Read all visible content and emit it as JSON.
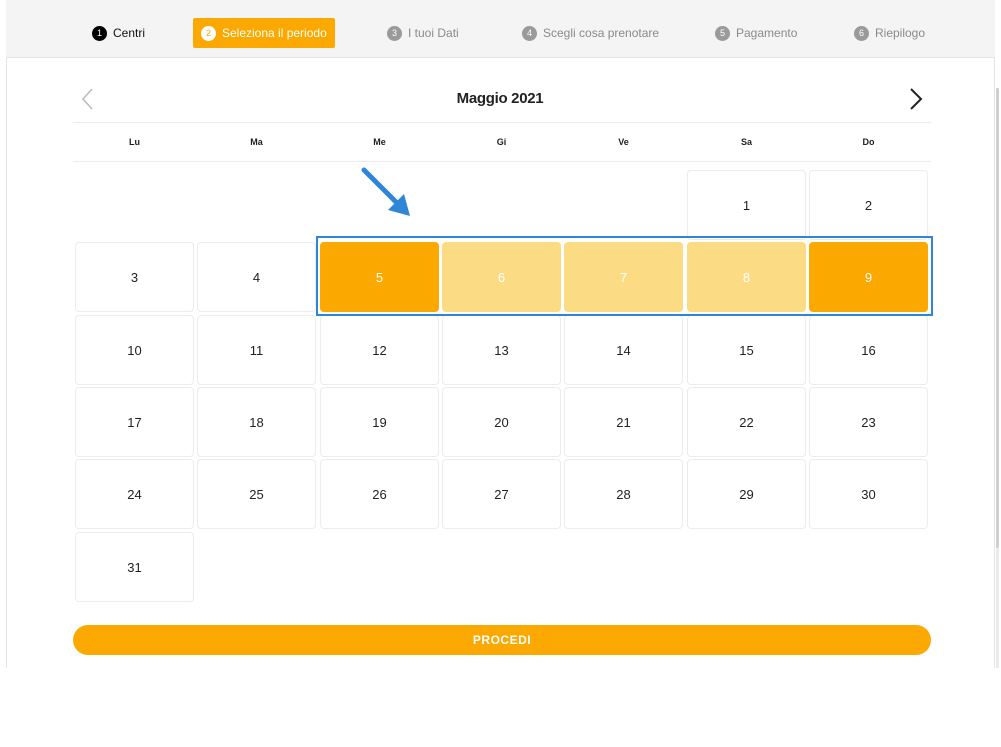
{
  "steps": [
    {
      "num": "1",
      "label": "Centri",
      "state": "done"
    },
    {
      "num": "2",
      "label": "Seleziona il periodo",
      "state": "active"
    },
    {
      "num": "3",
      "label": "I tuoi Dati",
      "state": "pending"
    },
    {
      "num": "4",
      "label": "Scegli cosa prenotare",
      "state": "pending"
    },
    {
      "num": "5",
      "label": "Pagamento",
      "state": "pending"
    },
    {
      "num": "6",
      "label": "Riepilogo",
      "state": "pending"
    }
  ],
  "calendar": {
    "month_title": "Maggio 2021",
    "weekdays": [
      "Lu",
      "Ma",
      "Me",
      "Gi",
      "Ve",
      "Sa",
      "Do"
    ],
    "days": [
      "1",
      "2",
      "3",
      "4",
      "5",
      "6",
      "7",
      "8",
      "9",
      "10",
      "11",
      "12",
      "13",
      "14",
      "15",
      "16",
      "17",
      "18",
      "19",
      "20",
      "21",
      "22",
      "23",
      "24",
      "25",
      "26",
      "27",
      "28",
      "29",
      "30",
      "31"
    ],
    "selected_range": {
      "start": "5",
      "end": "9"
    }
  },
  "icons": {
    "prev": "chevron-left-icon",
    "next": "chevron-right-icon",
    "annotation": "arrow-annotation-icon"
  },
  "colors": {
    "accent": "#fba900",
    "range_fill": "#fcdb85",
    "annotation": "#2f86d6"
  },
  "proceed_label": "PROCEDI"
}
